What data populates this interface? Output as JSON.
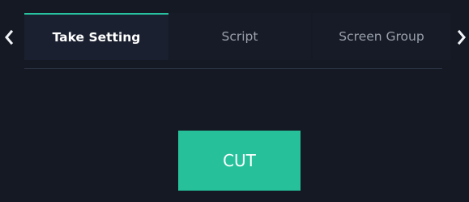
{
  "tabs": [
    {
      "label": "Take Setting",
      "active": true
    },
    {
      "label": "Script",
      "active": false
    },
    {
      "label": "Screen Group",
      "active": false
    }
  ],
  "icons": {
    "prev": "chevron-left-icon",
    "next": "chevron-right-icon"
  },
  "main": {
    "cut_label": "CUT"
  },
  "colors": {
    "background": "#141924",
    "accent": "#26c19b",
    "tab_active_bg": "#1b2030",
    "tab_inactive_text": "#9aa0aa"
  }
}
